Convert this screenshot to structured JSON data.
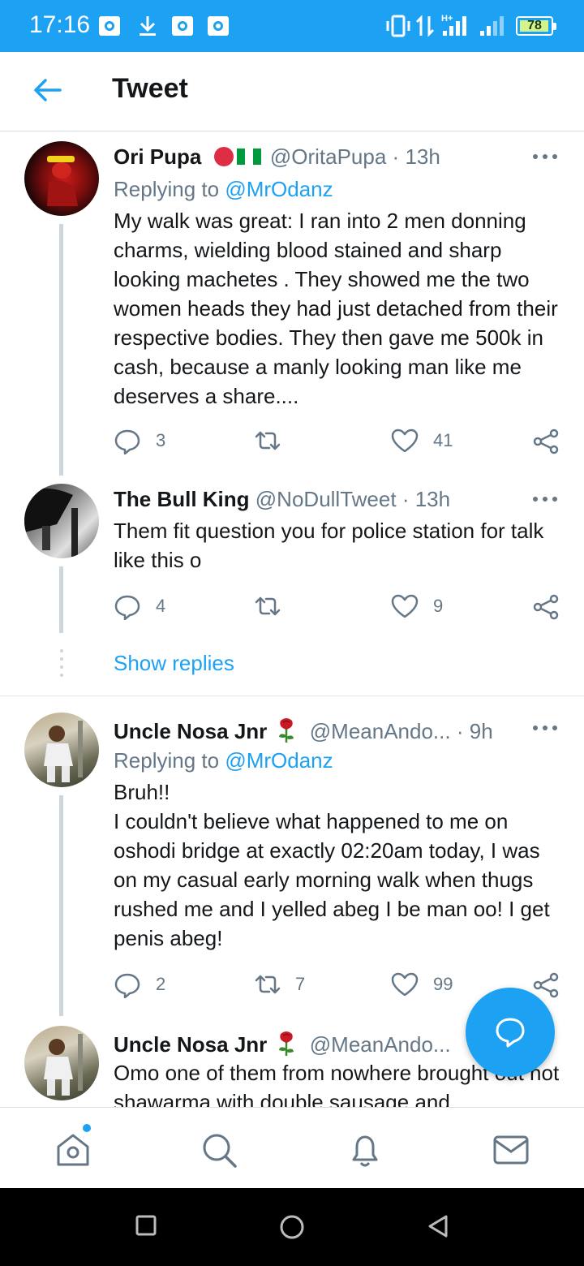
{
  "status_bar": {
    "time": "17:16",
    "battery": "78",
    "network": "H+"
  },
  "header": {
    "title": "Tweet",
    "back_icon": "arrow-left-icon"
  },
  "tweets": [
    {
      "name": "Ori Pupa",
      "handle": "@OritaPupa",
      "time": "13h",
      "replying_label": "Replying to",
      "replying_to": "@MrOdanz",
      "text": "My walk was great: I ran into 2 men donning charms, wielding blood stained and sharp looking machetes . They showed me the two women heads they had just detached from their respective bodies. They then gave me 500k in cash, because a manly looking man like me deserves a share....",
      "replies": "3",
      "retweets": "",
      "likes": "41"
    },
    {
      "name": "The Bull King",
      "handle": "@NoDullTweet",
      "time": "13h",
      "text": "Them fit question you for police station for talk like this o",
      "replies": "4",
      "retweets": "",
      "likes": "9"
    },
    {
      "name": "Uncle Nosa Jnr",
      "handle": "@MeanAndo...",
      "time": "9h",
      "replying_label": "Replying to",
      "replying_to": "@MrOdanz",
      "text": "Bruh!!\nI couldn't believe what happened to me on oshodi bridge at exactly 02:20am today, I was on my casual early morning walk when thugs rushed me and I yelled abeg I be man oo! I get penis abeg!",
      "replies": "2",
      "retweets": "7",
      "likes": "99"
    },
    {
      "name": "Uncle Nosa Jnr",
      "handle": "@MeanAndo...",
      "text": "Omo one of them from nowhere brought out hot shawarma with double sausage and"
    }
  ],
  "show_replies": "Show replies",
  "separator": "·",
  "colors": {
    "accent": "#1da1f2",
    "text": "#14171a",
    "secondary": "#657786",
    "thread_line": "#ccd6dd"
  },
  "bottom_nav": [
    "home-icon",
    "search-icon",
    "bell-icon",
    "mail-icon"
  ],
  "fab_icon": "speech-bubble-icon"
}
